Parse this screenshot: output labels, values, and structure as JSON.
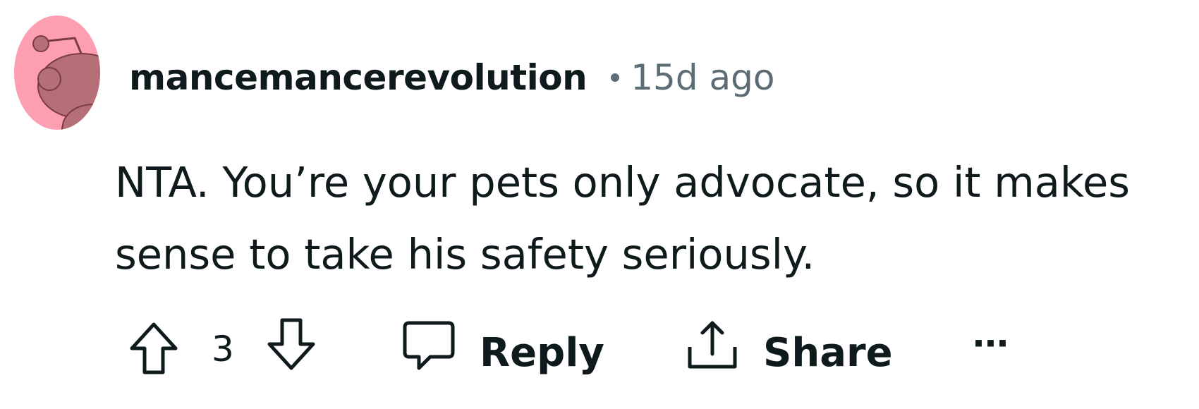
{
  "comment": {
    "username": "mancemancerevolution",
    "time": "15d ago",
    "body": "NTA. You’re your pets only advocate, so it makes sense to take his safety seriously.",
    "vote_count": "3"
  },
  "actions": {
    "reply_label": "Reply",
    "share_label": "Share",
    "more_label": "···"
  },
  "icons": {
    "avatar": "snoo-avatar",
    "upvote": "upvote-arrow-icon",
    "downvote": "downvote-arrow-icon",
    "reply": "speech-bubble-icon",
    "share": "share-upload-icon",
    "more": "overflow-dots-icon"
  },
  "colors": {
    "avatar_background": "#fd9fb0",
    "avatar_figure": "#b56f77",
    "text": "#0f1a1c",
    "meta_text": "#5c6c74"
  }
}
